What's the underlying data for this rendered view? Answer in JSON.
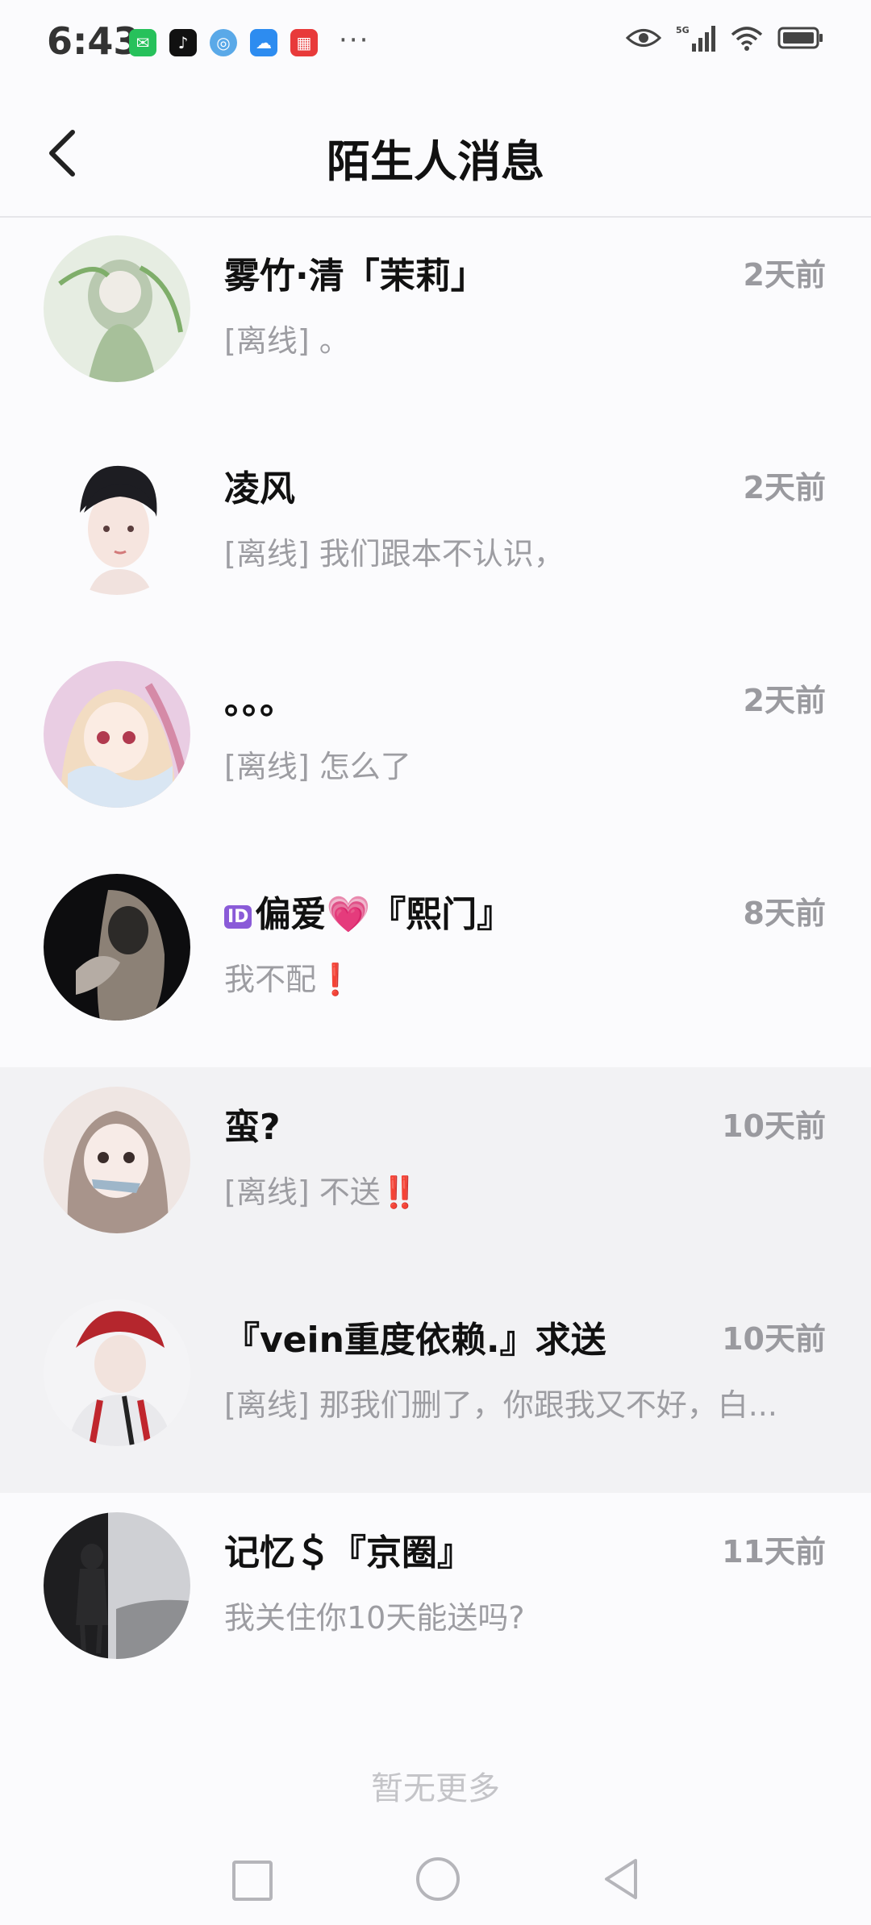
{
  "status": {
    "time": "6:43",
    "more": "···"
  },
  "header": {
    "title": "陌生人消息"
  },
  "conversations": [
    {
      "name": "雾竹·清「茉莉」",
      "time": "2天前",
      "preview": "[离线] 。"
    },
    {
      "name": "凌风",
      "time": "2天前",
      "preview": "[离线] 我们跟本不认识，"
    },
    {
      "name": "。。。",
      "time": "2天前",
      "preview": "[离线] 怎么了"
    },
    {
      "name_prefix": "ID",
      "name_mid": "偏爱",
      "name_heart": "💗",
      "name_suffix": "『熙门』",
      "time": "8天前",
      "preview_text": "我不配",
      "preview_mark": "❗"
    },
    {
      "name": "蛮?",
      "time": "10天前",
      "preview_text": "[离线] 不送",
      "preview_mark": "‼️"
    },
    {
      "name": "『vein重度依赖.』求送",
      "time": "10天前",
      "preview": "[离线] 那我们删了，你跟我又不好，白..."
    },
    {
      "name": "记忆＄『京圈』",
      "time": "11天前",
      "preview": "我关住你10天能送吗?"
    }
  ],
  "footer": {
    "no_more": "暂无更多"
  }
}
